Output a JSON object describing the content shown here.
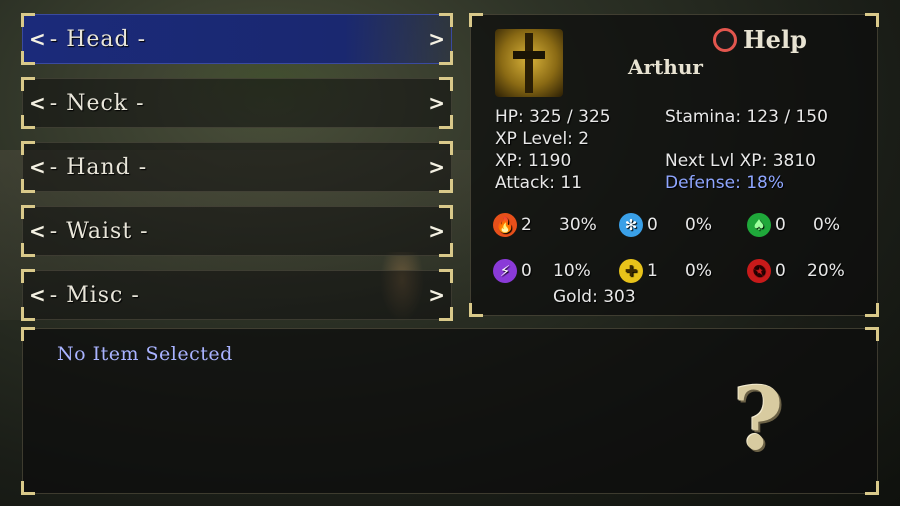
{
  "slots": [
    {
      "label": "- Head -",
      "selected": true
    },
    {
      "label": "- Neck -",
      "selected": false
    },
    {
      "label": "- Hand -",
      "selected": false
    },
    {
      "label": "- Waist -",
      "selected": false
    },
    {
      "label": "- Misc -",
      "selected": false
    }
  ],
  "help": {
    "label": "Help"
  },
  "character": {
    "name": "Arthur",
    "hp": "HP: 325 / 325",
    "stamina": "Stamina: 123 / 150",
    "xp_level": "XP Level: 2",
    "xp": "XP: 1190",
    "next_lvl_xp": "Next Lvl XP: 3810",
    "attack": "Attack: 11",
    "defense": "Defense: 18%",
    "gold": "Gold: 303"
  },
  "resistances": [
    {
      "icon": "fire-icon",
      "level": "2",
      "percent": "30%",
      "color": "#e8501a"
    },
    {
      "icon": "ice-icon",
      "level": "0",
      "percent": "0%",
      "color": "#3aa0e8"
    },
    {
      "icon": "poison-icon",
      "level": "0",
      "percent": "0%",
      "color": "#1fa83a"
    },
    {
      "icon": "lightning-icon",
      "level": "0",
      "percent": "10%",
      "color": "#8a3ad8"
    },
    {
      "icon": "holy-icon",
      "level": "1",
      "percent": "0%",
      "color": "#e8c31a"
    },
    {
      "icon": "unholy-icon",
      "level": "0",
      "percent": "20%",
      "color": "#c81a1a"
    }
  ],
  "description": {
    "text": "No Item Selected"
  }
}
